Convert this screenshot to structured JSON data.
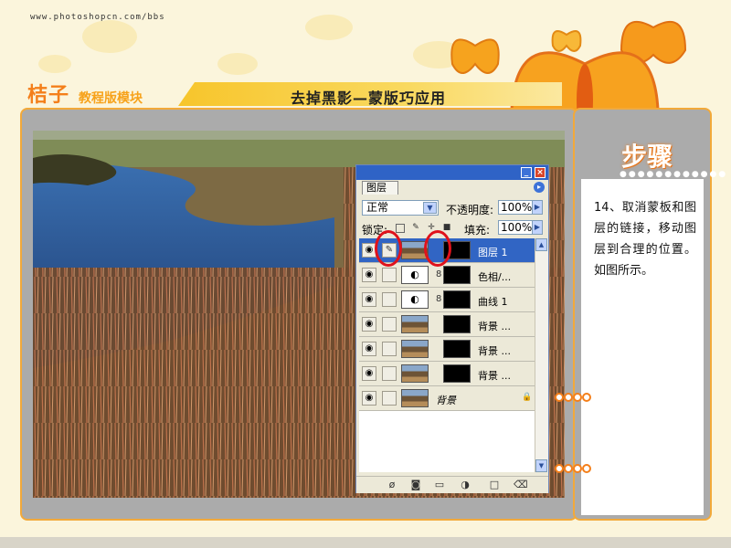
{
  "header": {
    "site_url": "www.photoshopcn.com/bbs",
    "brand_main": "桔子",
    "brand_sub": "教程版模块",
    "lesson_title": "去掉黑影—蒙版巧应用"
  },
  "step": {
    "title": "步骤",
    "dots": "●●●●●●●●●●●●",
    "text": "14、取消蒙板和图层的链接，移动图层到合理的位置。如图所示。"
  },
  "layers_palette": {
    "tab_label": "图层",
    "menu_glyph": "▸",
    "minimize_glyph": "_",
    "close_glyph": "×",
    "blend_mode": "正常",
    "opacity_label": "不透明度:",
    "opacity_value": "100%",
    "lock_label": "锁定:",
    "fill_label": "填充:",
    "fill_value": "100%",
    "layers": [
      {
        "name": "图层 1",
        "visible_glyph": "◉",
        "link_glyph": "✎",
        "selected": true
      },
      {
        "name": "色相/...",
        "visible_glyph": "◉",
        "link_glyph": "",
        "selected": false
      },
      {
        "name": "曲线 1",
        "visible_glyph": "◉",
        "link_glyph": "",
        "selected": false
      },
      {
        "name": "背景 ...",
        "visible_glyph": "◉",
        "link_glyph": "",
        "selected": false
      },
      {
        "name": "背景 ...",
        "visible_glyph": "◉",
        "link_glyph": "",
        "selected": false
      },
      {
        "name": "背景 ...",
        "visible_glyph": "◉",
        "link_glyph": "",
        "selected": false
      },
      {
        "name": "背景",
        "visible_glyph": "◉",
        "link_glyph": "",
        "selected": false
      }
    ],
    "adjust_glyph": "◐",
    "chain_glyph": "8",
    "lock_glyph": "🔒"
  },
  "colors": {
    "accent_orange": "#f47f1a",
    "panel_border": "#f2a93a",
    "selection_blue": "#3165c4",
    "annotation_red": "#e0121b"
  }
}
